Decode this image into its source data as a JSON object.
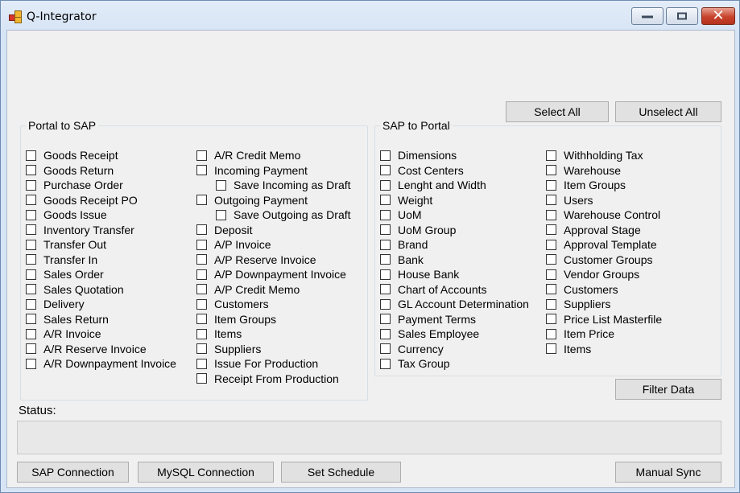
{
  "window": {
    "title": "Q-Integrator",
    "close_glyph": "✕"
  },
  "toolbar": {
    "select_all": "Select All",
    "unselect_all": "Unselect All",
    "filter_data": "Filter Data"
  },
  "portal_to_sap": {
    "title": "Portal to SAP",
    "col1": [
      "Goods Receipt",
      "Goods Return",
      "Purchase Order",
      "Goods Receipt PO",
      "Goods Issue",
      "Inventory Transfer",
      "Transfer Out",
      "Transfer In",
      "Sales Order",
      "Sales Quotation",
      "Delivery",
      "Sales Return",
      "A/R Invoice",
      "A/R Reserve Invoice",
      "A/R Downpayment Invoice"
    ],
    "col2": [
      {
        "label": "A/R Credit Memo",
        "indent": false
      },
      {
        "label": "Incoming Payment",
        "indent": false
      },
      {
        "label": "Save Incoming as Draft",
        "indent": true
      },
      {
        "label": "Outgoing Payment",
        "indent": false
      },
      {
        "label": "Save Outgoing as Draft",
        "indent": true
      },
      {
        "label": "Deposit",
        "indent": false
      },
      {
        "label": "A/P Invoice",
        "indent": false
      },
      {
        "label": "A/P Reserve Invoice",
        "indent": false
      },
      {
        "label": "A/P Downpayment Invoice",
        "indent": false
      },
      {
        "label": "A/P Credit Memo",
        "indent": false
      },
      {
        "label": "Customers",
        "indent": false
      },
      {
        "label": "Item Groups",
        "indent": false
      },
      {
        "label": "Items",
        "indent": false
      },
      {
        "label": "Suppliers",
        "indent": false
      },
      {
        "label": "Issue For Production",
        "indent": false
      },
      {
        "label": "Receipt From Production",
        "indent": false
      }
    ]
  },
  "sap_to_portal": {
    "title": "SAP to Portal",
    "col1": [
      "Dimensions",
      "Cost Centers",
      "Lenght and Width",
      "Weight",
      "UoM",
      "UoM Group",
      "Brand",
      "Bank",
      "House Bank",
      "Chart of Accounts",
      "GL Account Determination",
      "Payment Terms",
      "Sales Employee",
      "Currency",
      "Tax Group"
    ],
    "col2": [
      "Withholding Tax",
      "Warehouse",
      "Item Groups",
      "Users",
      "Warehouse Control",
      "Approval Stage",
      "Approval Template",
      "Customer Groups",
      "Vendor Groups",
      "Customers",
      "Suppliers",
      "Price List Masterfile",
      "Item Price",
      "Items"
    ]
  },
  "status": {
    "label": "Status:",
    "value": ""
  },
  "footer": {
    "sap_connection": "SAP Connection",
    "mysql_connection": "MySQL Connection",
    "set_schedule": "Set Schedule",
    "manual_sync": "Manual Sync"
  }
}
